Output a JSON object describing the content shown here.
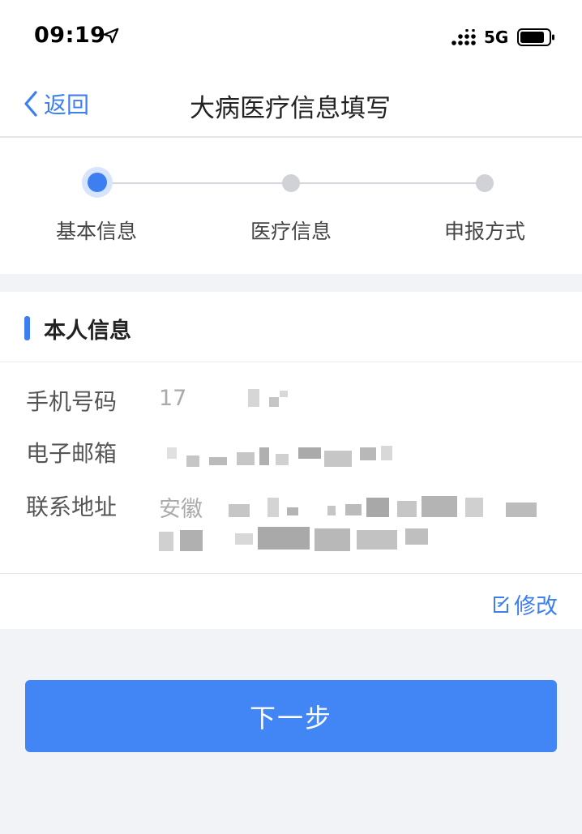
{
  "status_bar": {
    "time": "09:19",
    "network": "5G",
    "icons": [
      "location-arrow-icon",
      "signal-icon",
      "battery-icon"
    ]
  },
  "nav": {
    "back_label": "返回",
    "title": "大病医疗信息填写"
  },
  "steps": [
    {
      "label": "基本信息",
      "active": true
    },
    {
      "label": "医疗信息",
      "active": false
    },
    {
      "label": "申报方式",
      "active": false
    }
  ],
  "section": {
    "title": "本人信息"
  },
  "fields": {
    "phone": {
      "label": "手机号码",
      "value_visible": "17"
    },
    "email": {
      "label": "电子邮箱"
    },
    "address": {
      "label": "联系地址",
      "value_visible": "安徽"
    }
  },
  "edit": {
    "label": "修改"
  },
  "next_button": {
    "label": "下一步"
  },
  "colors": {
    "accent": "#3d7ff0",
    "button": "#4285f4",
    "background": "#f2f3f7"
  }
}
